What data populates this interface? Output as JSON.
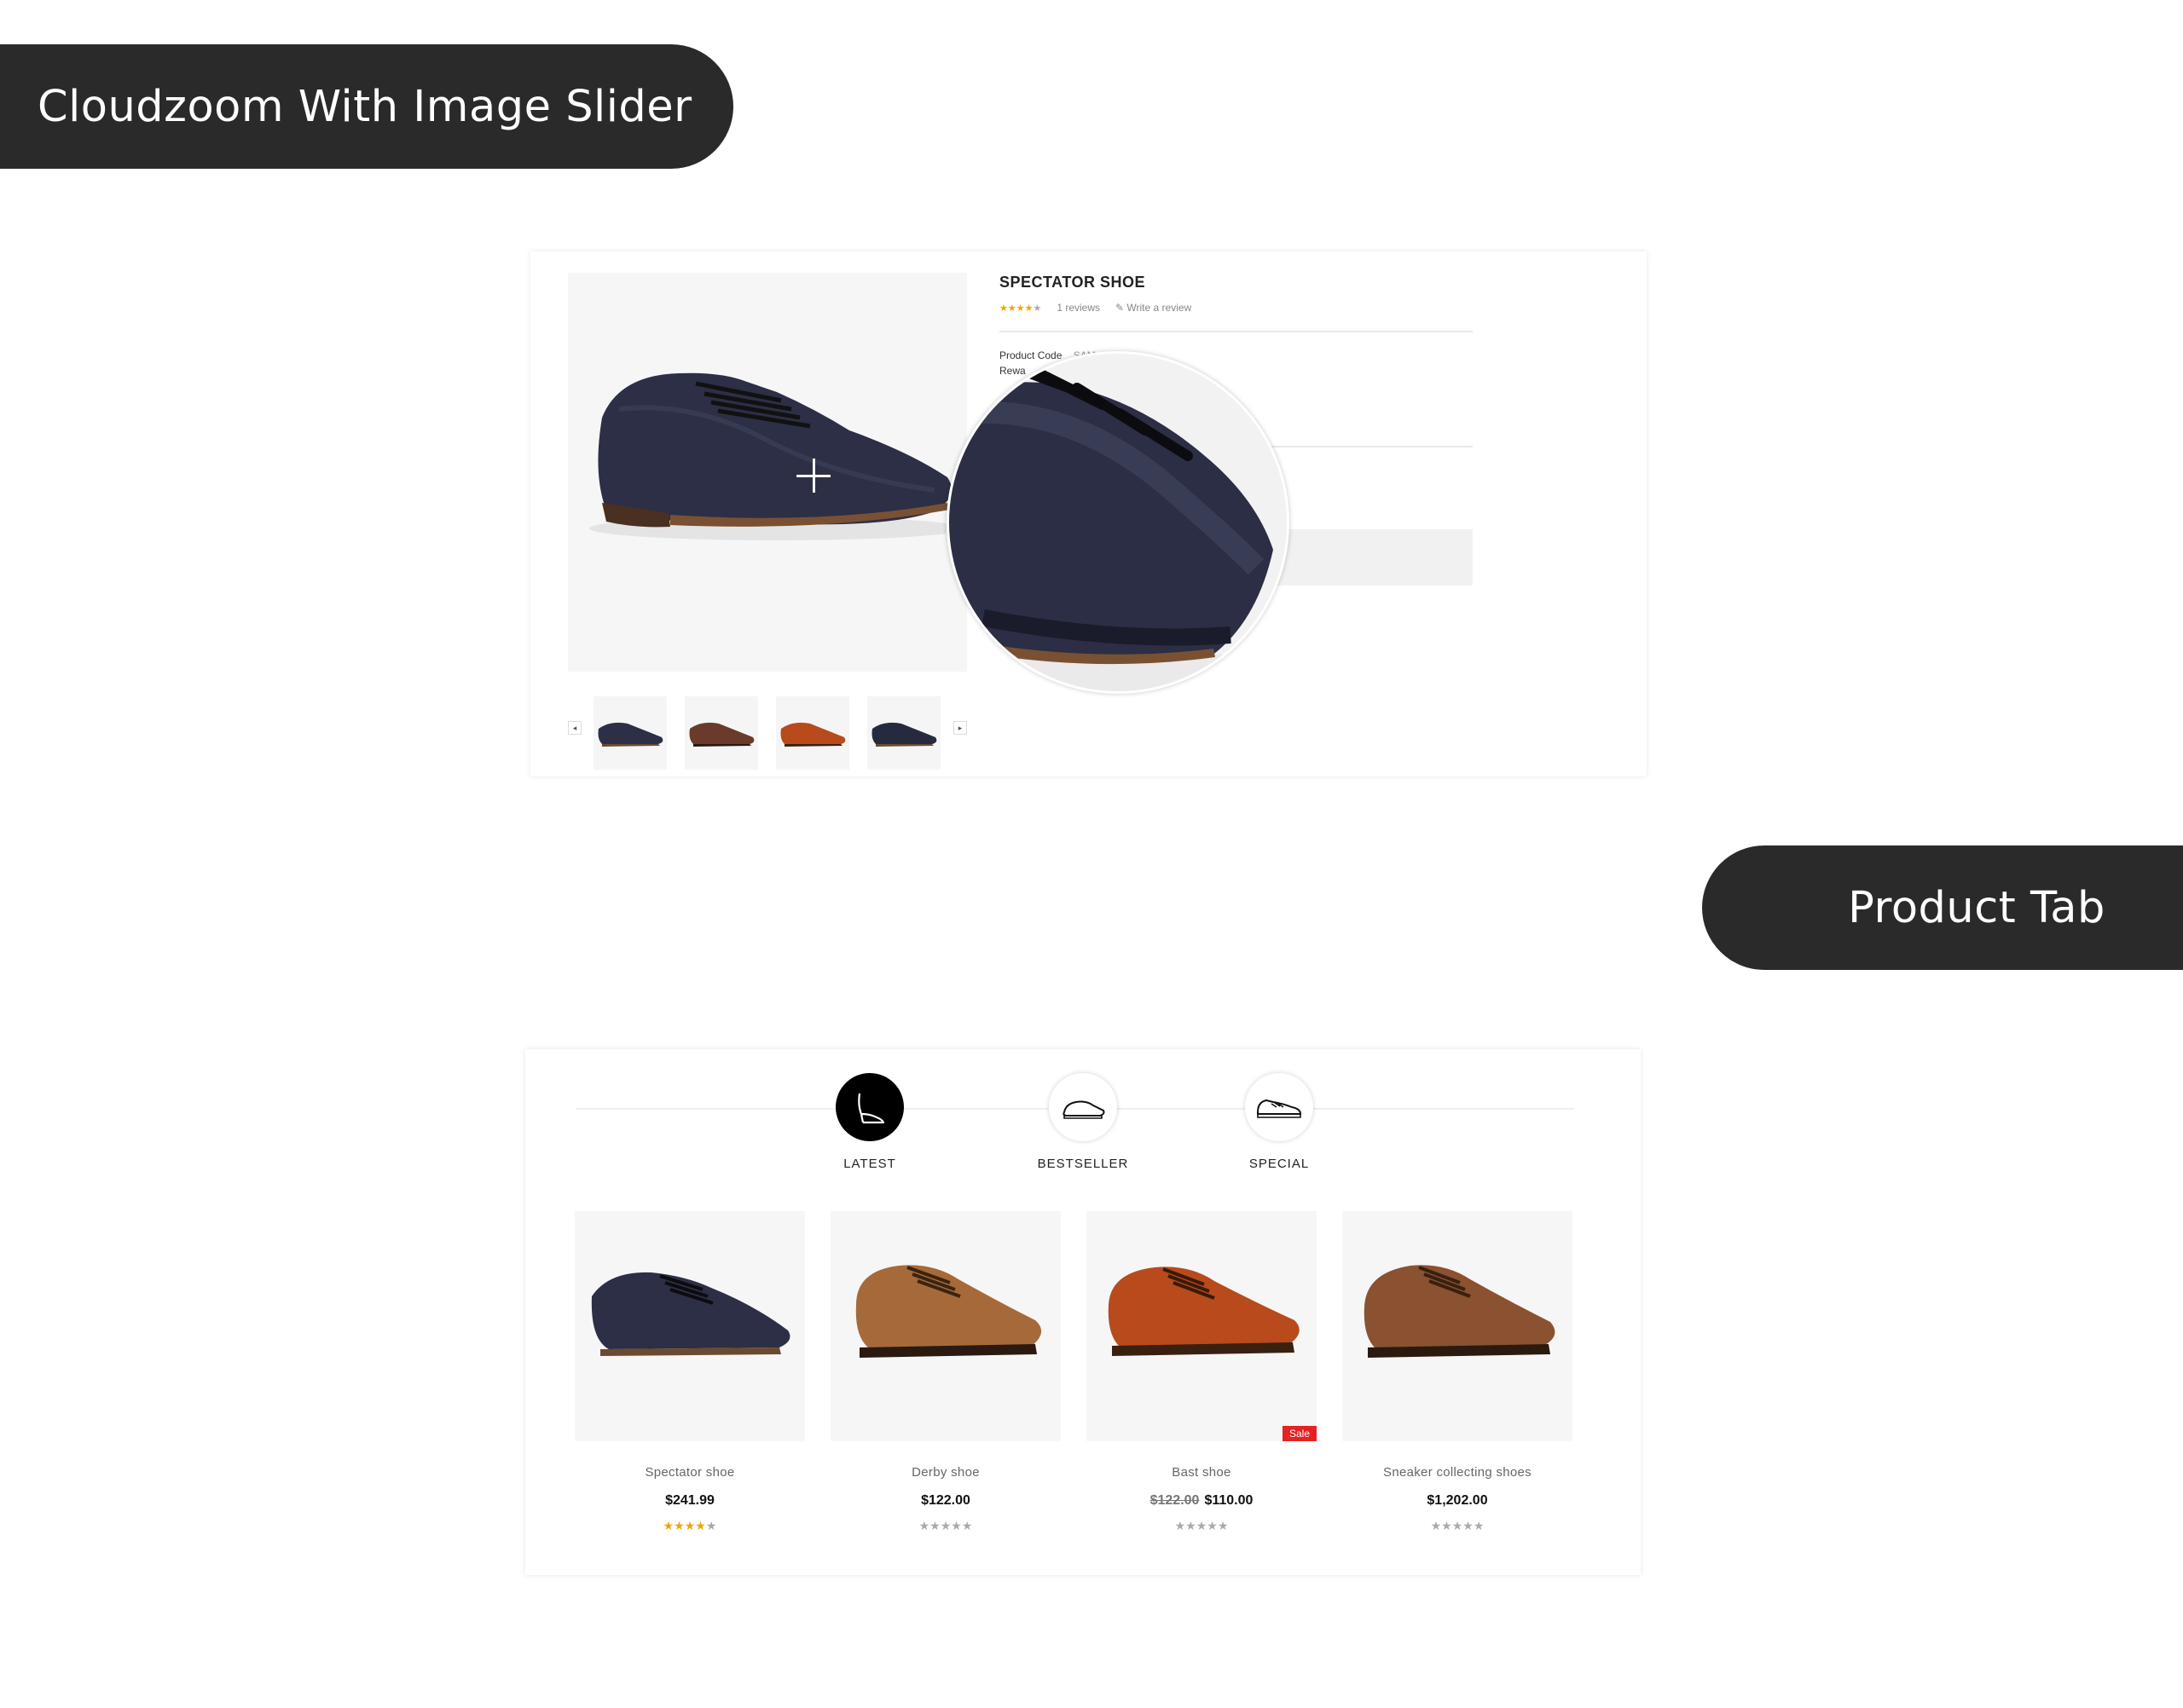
{
  "banners": {
    "cloudzoom": "Cloudzoom With Image Slider",
    "product_tab": "Product Tab"
  },
  "zoom_demo": {
    "title": "SPECTATOR SHOE",
    "stars_filled": 4,
    "stars_total": 5,
    "reviews": "1 reviews",
    "write_review": "Write a review",
    "specs": [
      {
        "label": "Product Code",
        "value": "SAM"
      },
      {
        "label": "Rewa",
        "value": ""
      }
    ],
    "thumb_prev": "◂",
    "thumb_next": "▸"
  },
  "tabs": [
    {
      "label": "LATEST",
      "icon": "high-heel-icon",
      "active": true
    },
    {
      "label": "BESTSELLER",
      "icon": "slipper-icon",
      "active": false
    },
    {
      "label": "SPECIAL",
      "icon": "sneaker-icon",
      "active": false
    }
  ],
  "products": [
    {
      "name": "Spectator shoe",
      "price": "$241.99",
      "old_price": "",
      "sale": false,
      "stars_filled": 4
    },
    {
      "name": "Derby shoe",
      "price": "$122.00",
      "old_price": "",
      "sale": false,
      "stars_filled": 0
    },
    {
      "name": "Bast shoe",
      "price": "$110.00",
      "old_price": "$122.00",
      "sale": true,
      "stars_filled": 0
    },
    {
      "name": "Sneaker collecting shoes",
      "price": "$1,202.00",
      "old_price": "",
      "sale": false,
      "stars_filled": 0
    }
  ],
  "sale_label": "Sale",
  "colors": {
    "banner_bg": "#2a2a2a",
    "star": "#f0a500",
    "sale": "#e32222",
    "shoe_navy": "#2c2f45",
    "shoe_brown": "#8a5230",
    "shoe_tan": "#a66a3a",
    "shoe_orange": "#b84a1c"
  }
}
